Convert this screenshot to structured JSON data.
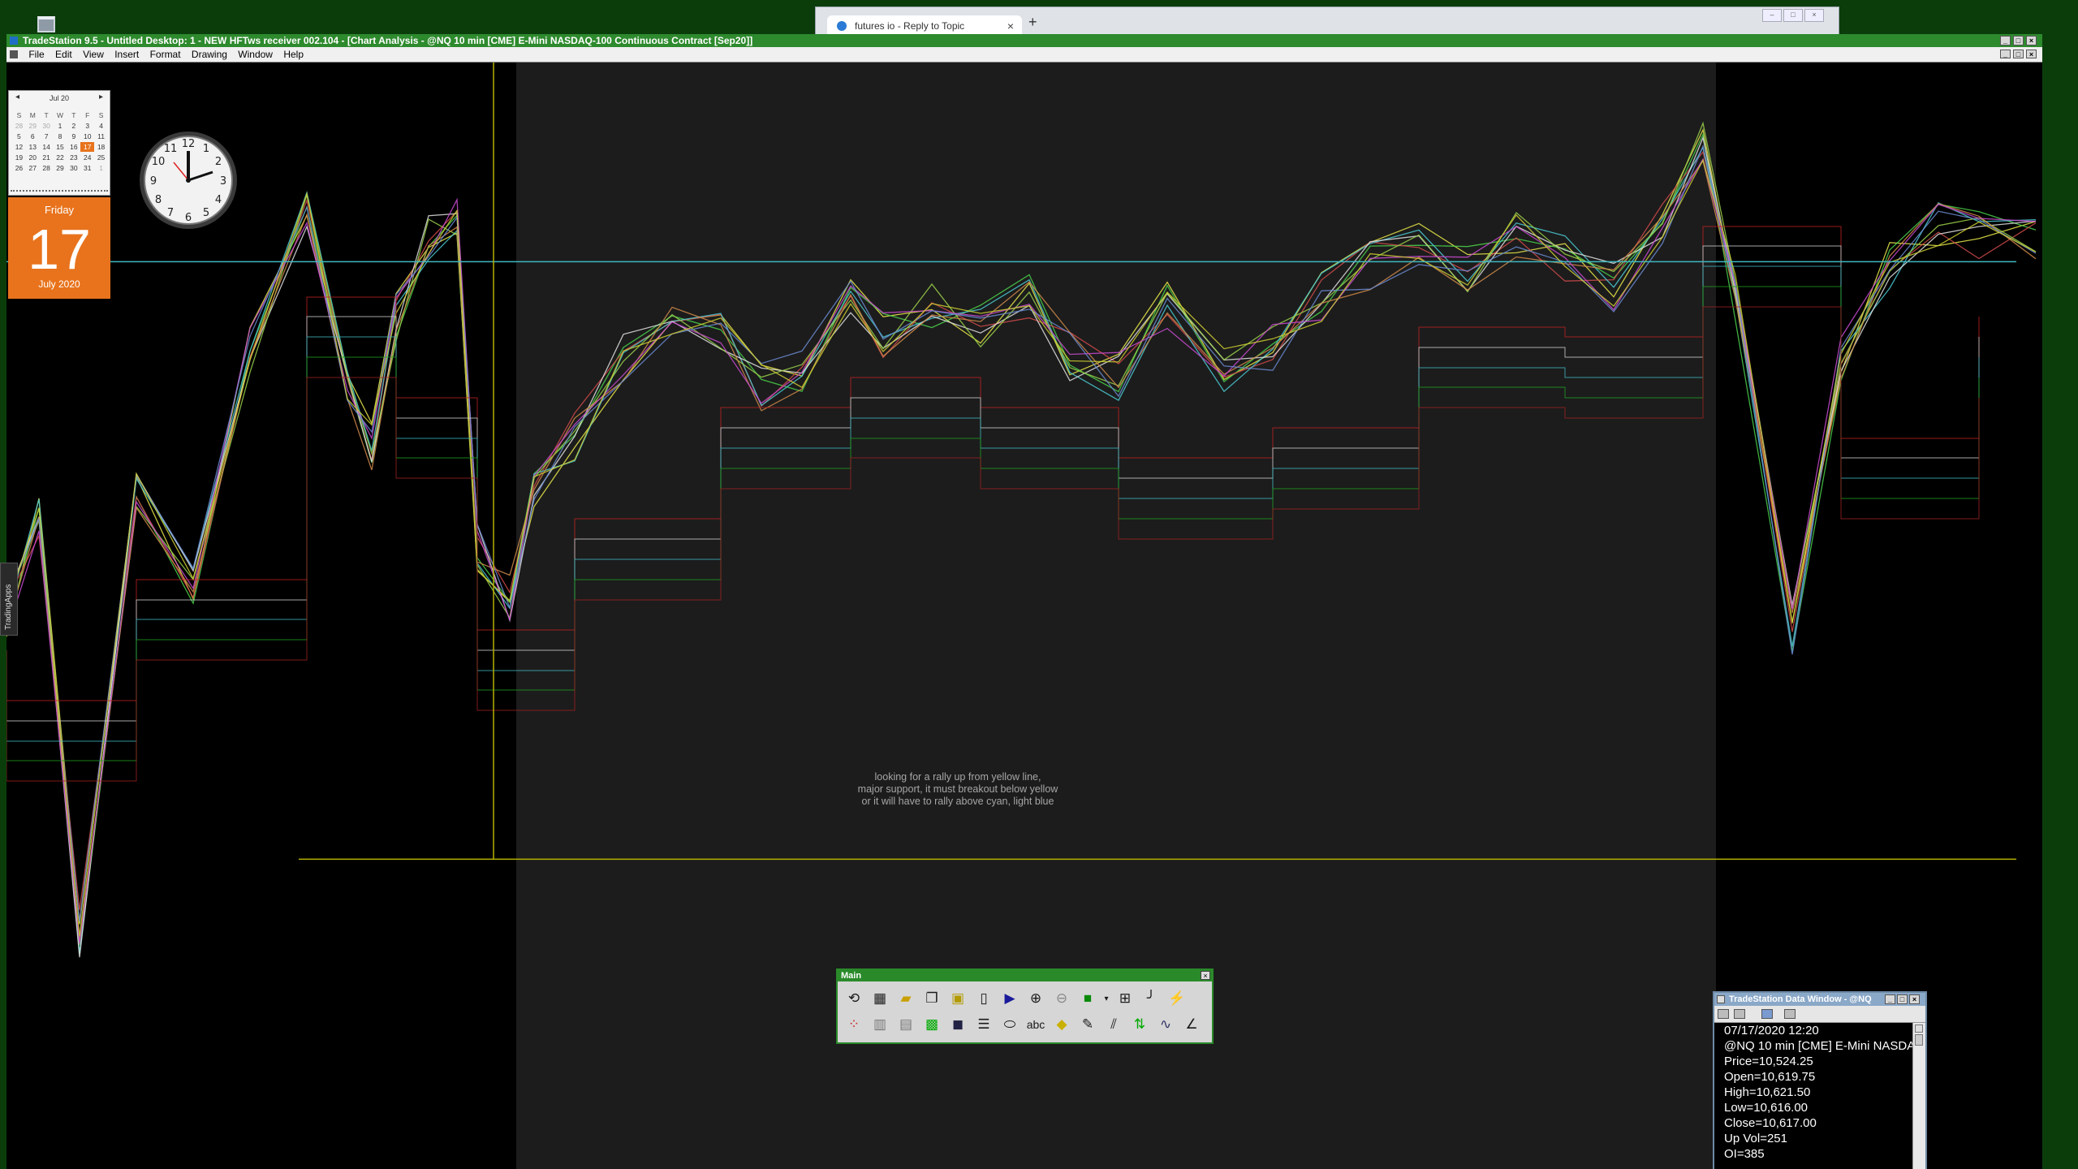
{
  "desktop": {
    "recycle_icon": "recycle-bin-icon"
  },
  "browser": {
    "tab_title": "futures io - Reply to Topic",
    "tab_close": "×",
    "new_tab": "+"
  },
  "window": {
    "title": "TradeStation 9.5 - Untitled Desktop: 1 - NEW HFTws receiver 002.104 - [Chart Analysis - @NQ 10 min [CME] E-Mini NASDAQ-100 Continuous Contract [Sep20]]",
    "menu": [
      "File",
      "Edit",
      "View",
      "Insert",
      "Format",
      "Drawing",
      "Window",
      "Help"
    ]
  },
  "calendar": {
    "month_label": "Jul 20",
    "weekdays": [
      "S",
      "M",
      "T",
      "W",
      "T",
      "F",
      "S"
    ],
    "days": [
      [
        "28",
        "29",
        "30",
        "1",
        "2",
        "3",
        "4"
      ],
      [
        "5",
        "6",
        "7",
        "8",
        "9",
        "10",
        "11"
      ],
      [
        "12",
        "13",
        "14",
        "15",
        "16",
        "17",
        "18"
      ],
      [
        "19",
        "20",
        "21",
        "22",
        "23",
        "24",
        "25"
      ],
      [
        "26",
        "27",
        "28",
        "29",
        "30",
        "31",
        "1"
      ]
    ],
    "today_weekday": "Friday",
    "today_day": "17",
    "today_month_year": "July 2020"
  },
  "side_tab": {
    "label": "TradingApps"
  },
  "chart_annotation": [
    "looking for a rally up from yellow line,",
    "major support, it must breakout below yellow",
    "or it will have to rally above cyan, light blue"
  ],
  "toolbar": {
    "title": "Main",
    "row1_icons": [
      "refresh-icon",
      "calculator-icon",
      "open-folder-icon",
      "copy-windows-icon",
      "save-workspace-icon",
      "new-page-icon",
      "play-to-end-icon",
      "zoom-in-icon",
      "zoom-out-icon",
      "chart-style-icon",
      "dropdown-arrow-icon",
      "grid-icon",
      "trendline-icon",
      "fork-icon"
    ],
    "row2_icons": [
      "dot-indicator-icon",
      "bar-chart-icon",
      "spreadsheet-icon",
      "colored-bars-icon",
      "cube-icon",
      "lines-icon",
      "ellipse-icon",
      "text-abc-icon",
      "eraser-icon",
      "pencil-icon",
      "channel-icon",
      "arrow-up-down-icon",
      "wave-icon",
      "angle-line-icon"
    ],
    "row2_text_button": "abc"
  },
  "data_window": {
    "title": "TradeStation Data Window - @NQ",
    "lines": [
      "07/17/2020 12:20",
      "@NQ 10 min [CME] E-Mini NASDAQ",
      "Price=10,524.25",
      "Open=10,619.75",
      "High=10,621.50",
      "Low=10,616.00",
      "Close=10,617.00",
      "Up Vol=251",
      "OI=385"
    ]
  },
  "colors": {
    "desktop_bg": "#0b3d0b",
    "titlebar": "#2d8a2d",
    "chart_bg_left": "#000000",
    "chart_bg_mid": "#1c1c1c",
    "accent_orange": "#e8731c",
    "support_yellow": "#b5b000",
    "resistance_cyan": "#3fb8c0"
  }
}
